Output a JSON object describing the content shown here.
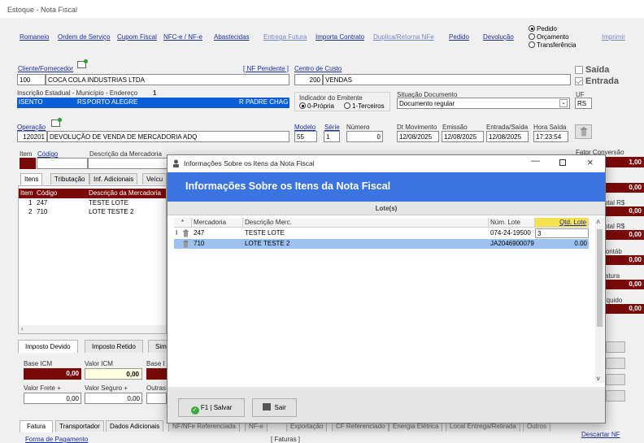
{
  "window": {
    "title": "Estoque - Nota Fiscal"
  },
  "menu": {
    "items": [
      "Romaneio",
      "Ordem de Serviço",
      "Cupom Fiscal",
      "NFC-e / NF-e",
      "Abastecidas",
      "Entrega Futura",
      "Importa Contrato",
      "Duplica/Retorna NFe",
      "Pedido",
      "Devolução"
    ],
    "right_item": "Imprimir",
    "radio_options": [
      "Pedido",
      "Orçamento",
      "Transferência"
    ]
  },
  "header": {
    "cliente_label": "Cliente/Fornecedor",
    "nf_pendente": "[ NF Pendente ]",
    "cliente_code": "100",
    "cliente_name": "COCA COLA INDUSTRIAS LTDA",
    "centro_label": "Centro de Custo",
    "centro_code": "200",
    "centro_name": "VENDAS",
    "saida": "Saída",
    "entrada": "Entrada",
    "inscricao_label": "Inscrição Estadual - Município - Endereço",
    "inscricao_count": "1",
    "inscricao_value": "ISENTO",
    "uf_small": "RS",
    "municipio": "PORTO ALEGRE",
    "endereco": "R PADRE CHAG",
    "indicador_label": "Indicador do Emitente",
    "indicador_options": [
      "0-Própria",
      "1-Terceiros"
    ],
    "situacao_label": "Situação Documento",
    "situacao_value": "Documento regular",
    "uf_label": "UF",
    "uf_value": "RS",
    "operacao_label": "Operação",
    "operacao_code": "120201",
    "operacao_name": "DEVOLUÇÃO DE VENDA DE MERCADORIA ADQ",
    "modelo_label": "Modelo",
    "modelo_value": "55",
    "serie_label": "Série",
    "serie_value": "1",
    "numero_label": "Número",
    "numero_value": "0",
    "dt_mov_label": "Dt Movimento",
    "dt_mov_value": "12/08/2025",
    "emissao_label": "Emissão",
    "emissao_value": "12/08/2025",
    "entrada_saida_label": "Entrada/Saída",
    "entrada_saida_value": "12/08/2025",
    "hora_label": "Hora Saída",
    "hora_value": "17:23:54"
  },
  "items_header": {
    "item": "Item",
    "codigo": "Código",
    "descricao": "Descrição da Mercadoria",
    "fator": "Fator Conversão",
    "fator_value": "1,00"
  },
  "tabs": [
    "Itens",
    "Tributação",
    "Inf. Adicionais",
    "Veícu"
  ],
  "items_table": {
    "columns": [
      "Item",
      "Código",
      "Descrição da Mercadoria"
    ],
    "rows": [
      [
        "1",
        "247",
        "TESTE LOTE"
      ],
      [
        "2",
        "710",
        "LOTE TESTE 2"
      ]
    ]
  },
  "right_panel": {
    "labels": [
      "Total R$",
      "Total R$",
      "Contáb",
      "Fatura",
      "Líquido"
    ],
    "values": [
      "0,00",
      "0,00",
      "0,00",
      "0,00",
      "0,00",
      "0,00"
    ]
  },
  "tax_tabs": [
    "Imposto Devido",
    "Imposto Retido",
    "Simp"
  ],
  "taxes": {
    "base_icm_label": "Base ICM",
    "base_icm_value": "0,00",
    "valor_icm_label": "Valor ICM",
    "valor_icm_value": "0,00",
    "base_label": "Base I",
    "frete_label": "Valor Frete +",
    "frete_value": "0,00",
    "seguro_label": "Valor Seguro +",
    "seguro_value": "0,00",
    "outras_label": "Outras"
  },
  "bottom_tabs": [
    "Fatura",
    "Transportador",
    "Dados Adicionais",
    "NF/NFe Referenciada",
    "NF-e",
    "Exportação",
    "CF Referenciado",
    "Energia Elétrica",
    "Local Entrega/Retirada",
    "Outros"
  ],
  "bottom": {
    "forma_pagamento": "Forma de Pagamento",
    "faturas": "[ Faturas ]",
    "descartar": "Descartar NF"
  },
  "modal": {
    "title": "Informações Sobre os Itens da Nota Fiscal",
    "banner": "Informações Sobre os Itens da Nota Fiscal",
    "section": "Lote(s)",
    "columns": [
      "*",
      "Mercadoria",
      "Descrição Merc.",
      "Núm. Lote",
      "Qtd. Lote"
    ],
    "rows": [
      {
        "marker": "I",
        "mercadoria": "247",
        "descricao": "TESTE LOTE",
        "lote": "074-24-19500",
        "qtd": "3"
      },
      {
        "marker": "",
        "mercadoria": "710",
        "descricao": "LOTE TESTE 2",
        "lote": "JA2046900079",
        "qtd": "0.00"
      }
    ],
    "save_button": "F1 | Salvar",
    "exit_button": "Sair"
  }
}
